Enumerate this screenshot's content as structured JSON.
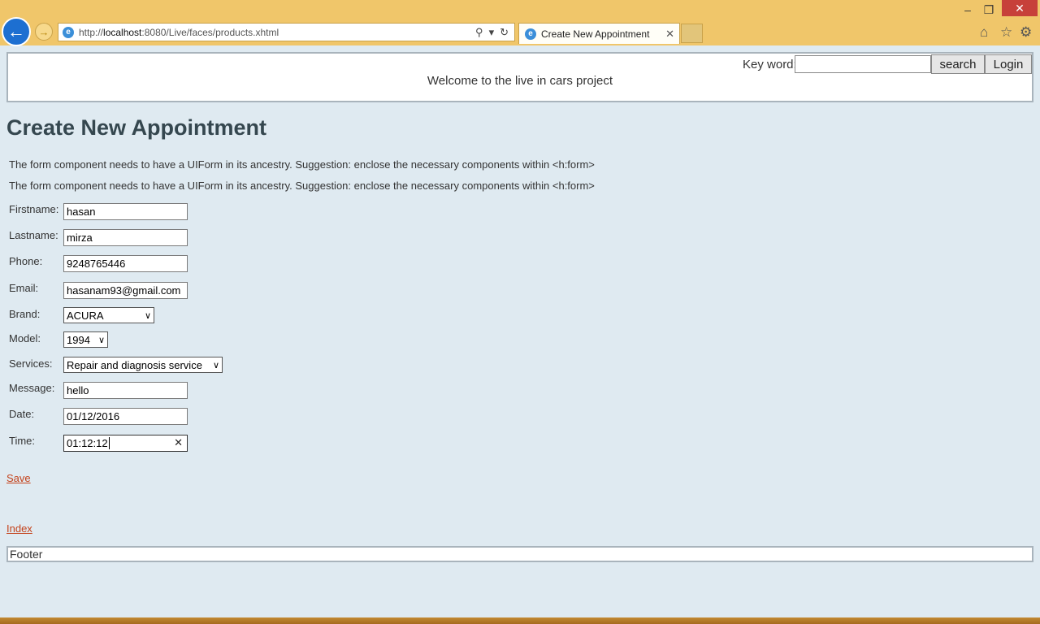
{
  "browser": {
    "url_prefix": "http://",
    "url_host": "localhost",
    "url_path": ":8080/Live/faces/products.xhtml",
    "tab_title": "Create New Appointment",
    "ie_icon": "e"
  },
  "header": {
    "keyword_label": "Key word:",
    "search_label": "search",
    "login_label": "Login",
    "welcome": "Welcome to the live in cars project"
  },
  "page": {
    "title": "Create New Appointment",
    "errors": [
      "The form component needs to have a UIForm in its ancestry. Suggestion: enclose the necessary components within <h:form>",
      "The form component needs to have a UIForm in its ancestry. Suggestion: enclose the necessary components within <h:form>"
    ]
  },
  "form": {
    "firstname": {
      "label": "Firstname:",
      "value": "hasan"
    },
    "lastname": {
      "label": "Lastname:",
      "value": "mirza"
    },
    "phone": {
      "label": "Phone:",
      "value": "9248765446"
    },
    "email": {
      "label": "Email:",
      "value": "hasanam93@gmail.com"
    },
    "brand": {
      "label": "Brand:",
      "value": "ACURA"
    },
    "model": {
      "label": "Model:",
      "value": "1994"
    },
    "services": {
      "label": "Services:",
      "value": "Repair and diagnosis service"
    },
    "message": {
      "label": "Message:",
      "value": "hello"
    },
    "date": {
      "label": "Date:",
      "value": "01/12/2016"
    },
    "time": {
      "label": "Time:",
      "value": "01:12:12"
    }
  },
  "links": {
    "save": "Save",
    "index": "Index"
  },
  "footer": {
    "text": "Footer"
  },
  "colors": {
    "chrome": "#f0c66a",
    "page_bg": "#dfeaf1",
    "link": "#c4431c",
    "title": "#35474f"
  }
}
